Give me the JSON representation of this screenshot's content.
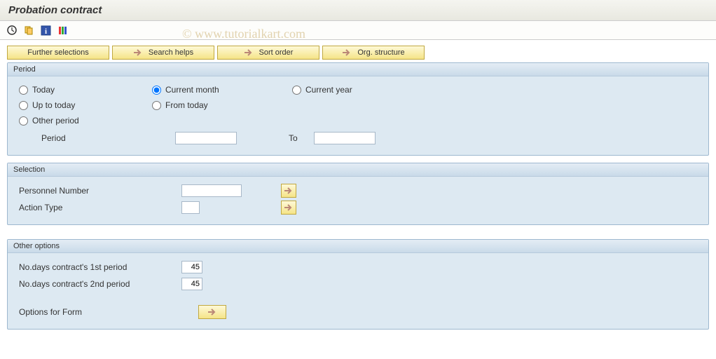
{
  "title": "Probation contract",
  "watermark": "© www.tutorialkart.com",
  "buttons": {
    "further": "Further selections",
    "search": "Search helps",
    "sort": "Sort order",
    "org": "Org. structure"
  },
  "period": {
    "title": "Period",
    "today": "Today",
    "current_month": "Current month",
    "current_year": "Current year",
    "up_to_today": "Up to today",
    "from_today": "From today",
    "other_period": "Other period",
    "period_label": "Period",
    "to_label": "To",
    "period_from": "",
    "period_to": ""
  },
  "selection": {
    "title": "Selection",
    "personnel_label": "Personnel Number",
    "personnel_value": "",
    "action_label": "Action Type",
    "action_value": ""
  },
  "other": {
    "title": "Other options",
    "days1_label": "No.days contract's 1st period",
    "days1_value": "45",
    "days2_label": "No.days contract's 2nd period",
    "days2_value": "45",
    "form_label": "Options for Form"
  }
}
